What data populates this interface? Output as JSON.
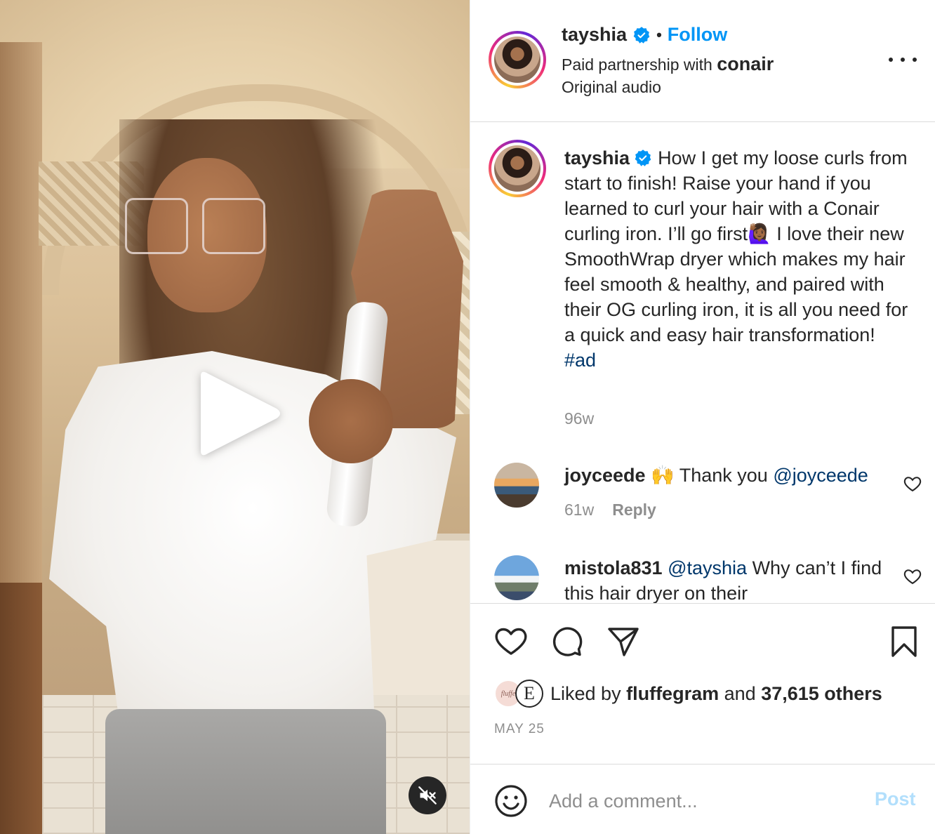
{
  "media": {
    "play_icon": "play-icon",
    "mute_icon": "muted-speaker-icon"
  },
  "header": {
    "username": "tayshia",
    "dot": "•",
    "follow_label": "Follow",
    "partnership_prefix": "Paid partnership with",
    "partner": "conair",
    "audio": "Original audio",
    "more_icon": "more-horizontal-icon"
  },
  "caption": {
    "username": "tayshia",
    "text": "How I get my loose curls from start to finish! Raise your hand if you learned to curl your hair with a Conair curling iron. I’ll go first🙋🏾‍♀️ I love their new SmoothWrap dryer which makes my hair feel smooth & healthy, and paired with their OG curling iron, it is all you need for a quick and easy hair transformation!",
    "hashtag": "#ad",
    "time": "96w"
  },
  "comments": [
    {
      "username": "joyceede",
      "text_prefix": "🙌 Thank you",
      "mention": "@joyceede",
      "text_suffix": "",
      "time": "61w",
      "reply_label": "Reply"
    },
    {
      "username": "mistola831",
      "text_prefix": "",
      "mention": "@tayshia",
      "text_suffix": "Why can’t I find this hair dryer on their",
      "time": "",
      "reply_label": ""
    }
  ],
  "actions": {
    "like_icon": "heart-icon",
    "comment_icon": "comment-bubble-icon",
    "share_icon": "paper-plane-icon",
    "save_icon": "bookmark-icon"
  },
  "likes": {
    "prefix": "Liked by",
    "user": "fluffegram",
    "and": "and",
    "others": "37,615 others",
    "avatar1_text": "fluffe",
    "avatar2_text": "E"
  },
  "date": "MAY 25",
  "add_comment": {
    "placeholder": "Add a comment...",
    "post_label": "Post",
    "emoji_icon": "smiley-icon"
  },
  "colors": {
    "accent": "#0095f6",
    "link": "#00376b",
    "muted": "#8e8e8e",
    "post_disabled": "#b2dffc"
  }
}
